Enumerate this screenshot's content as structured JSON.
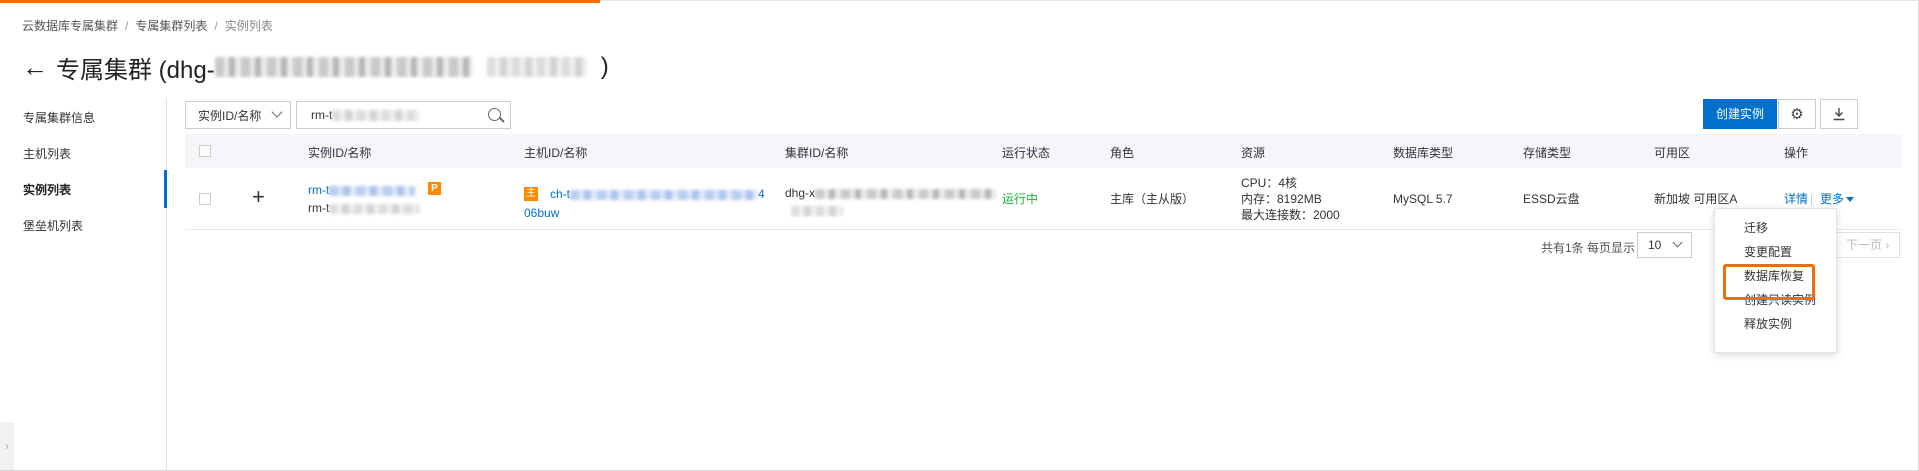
{
  "breadcrumb": [
    "云数据库专属集群",
    "专属集群列表",
    "实例列表"
  ],
  "header": {
    "back_icon": "arrow-left-icon",
    "title_prefix": "专属集群 (dhg-",
    "title_suffix": ")"
  },
  "sidebar": {
    "items": [
      "专属集群信息",
      "主机列表",
      "实例列表",
      "堡垒机列表"
    ],
    "active_index": 2
  },
  "toolbar": {
    "filter_select": "实例ID/名称",
    "search_value": "rm-t",
    "create_button": "创建实例",
    "settings_icon": "gear-icon",
    "download_icon": "download-icon"
  },
  "table": {
    "columns": [
      "实例ID/名称",
      "主机ID/名称",
      "集群ID/名称",
      "运行状态",
      "角色",
      "资源",
      "数据库类型",
      "存储类型",
      "可用区",
      "操作"
    ],
    "rows": [
      {
        "instance_id": "rm-t",
        "instance_name": "rm-t",
        "instance_badge": "P",
        "host_badge": "主",
        "host_id": "ch-t",
        "host_id_tail": "4",
        "host_name": "06buw",
        "cluster_id": "dhg-x",
        "status": "运行中",
        "role": "主库（主从版）",
        "resource_cpu": "CPU：4核",
        "resource_mem": "内存：8192MB",
        "resource_conn": "最大连接数：2000",
        "db_type": "MySQL 5.7",
        "storage_type": "ESSD云盘",
        "zone": "新加坡 可用区A",
        "action_detail": "详情",
        "action_more": "更多"
      }
    ]
  },
  "pagination": {
    "summary": "共有1条 每页显示",
    "page_size": "10",
    "next_label": "下一页"
  },
  "more_menu": {
    "items": [
      "迁移",
      "变更配置",
      "数据库恢复",
      "创建只读实例",
      "释放实例"
    ],
    "highlighted_index": 2
  },
  "colors": {
    "primary": "#0070cc",
    "accent": "#ff6a00",
    "badge": "#ff8a00",
    "running": "#1bb134",
    "highlight_box": "#f06c12"
  }
}
